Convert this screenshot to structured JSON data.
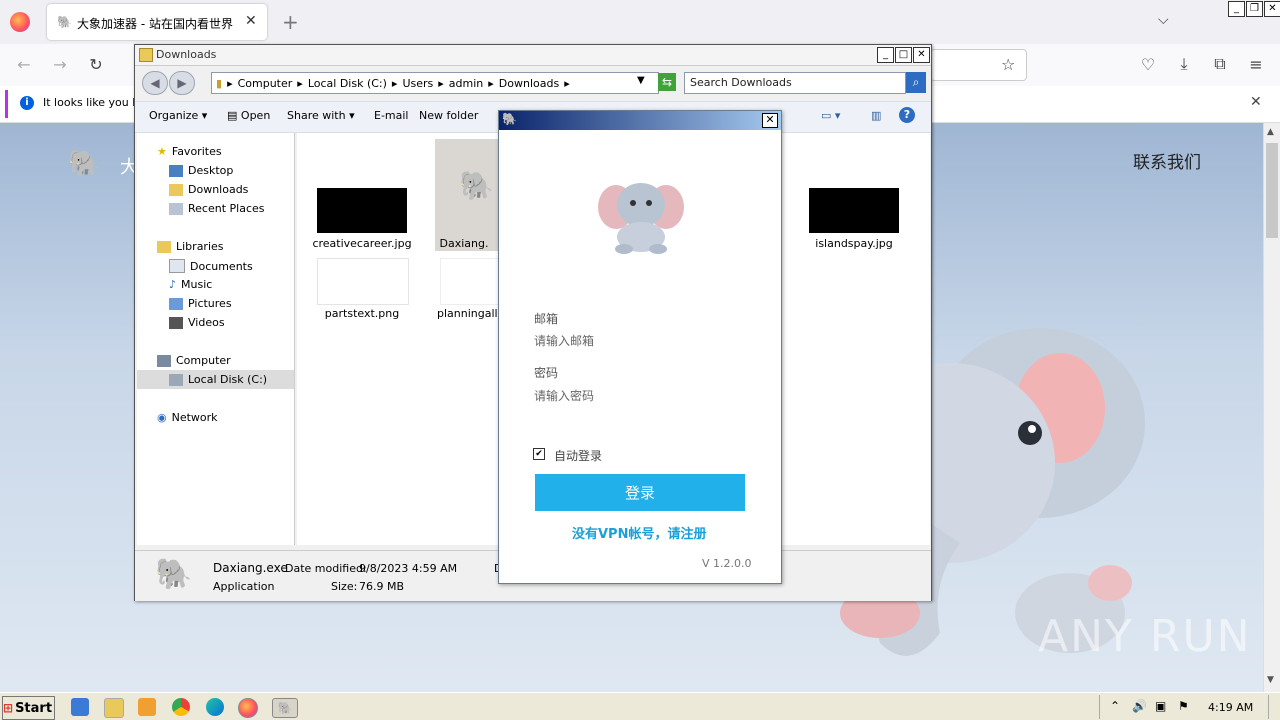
{
  "browser": {
    "tab_title": "大象加速器 - 站在国内看世界",
    "new_tab": "+",
    "info_text": "It looks like you ha",
    "url_partial": ""
  },
  "webpage": {
    "brand_partial": "大",
    "contact_link": "联系我们",
    "watermark": "ANY RUN"
  },
  "explorer": {
    "title": "Downloads",
    "breadcrumb": [
      "Computer",
      "Local Disk (C:)",
      "Users",
      "admin",
      "Downloads"
    ],
    "search_placeholder": "Search Downloads",
    "toolbar": {
      "organize": "Organize",
      "open": "Open",
      "share_with": "Share with",
      "email": "E-mail",
      "new_folder": "New folder"
    },
    "nav": {
      "favorites": "Favorites",
      "desktop": "Desktop",
      "downloads": "Downloads",
      "recent_places": "Recent Places",
      "libraries": "Libraries",
      "documents": "Documents",
      "music": "Music",
      "pictures": "Pictures",
      "videos": "Videos",
      "computer": "Computer",
      "local_disk": "Local Disk (C:)",
      "network": "Network"
    },
    "files": {
      "f1": "creativecareer.jpg",
      "f2": "Daxiang.",
      "f3": "islandspay.jpg",
      "f4": "partstext.png",
      "f5": "planningallc"
    },
    "status": {
      "name": "Daxiang.exe",
      "date_label": "Date modified:",
      "date_value": "9/8/2023 4:59 AM",
      "extra": "D",
      "type": "Application",
      "size_label": "Size:",
      "size_value": "76.9 MB"
    }
  },
  "login": {
    "email_label": "邮箱",
    "email_placeholder": "请输入邮箱",
    "password_label": "密码",
    "password_placeholder": "请输入密码",
    "auto_login": "自动登录",
    "login_button": "登录",
    "register_link": "没有VPN帐号，请注册",
    "version": "V 1.2.0.0"
  },
  "taskbar": {
    "start": "Start",
    "clock": "4:19 AM"
  }
}
